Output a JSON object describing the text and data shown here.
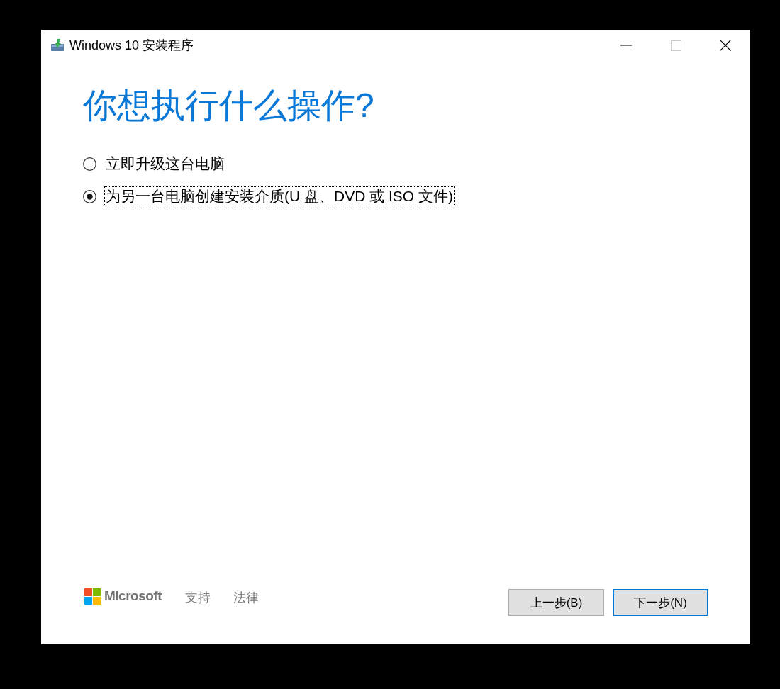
{
  "window": {
    "title": "Windows 10 安装程序",
    "caption_buttons": [
      {
        "kind": "minimize",
        "disabled": false
      },
      {
        "kind": "maximize",
        "disabled": true
      },
      {
        "kind": "close",
        "disabled": false
      }
    ]
  },
  "heading": "你想执行什么操作?",
  "options": [
    {
      "label": "立即升级这台电脑",
      "selected": false,
      "focused": false
    },
    {
      "label": "为另一台电脑创建安装介质(U 盘、DVD 或 ISO 文件)",
      "selected": true,
      "focused": true
    }
  ],
  "footer": {
    "brand": "Microsoft",
    "links": [
      "支持",
      "法律"
    ]
  },
  "buttons": [
    {
      "label": "上一步(B)",
      "default": false
    },
    {
      "label": "下一步(N)",
      "default": true
    }
  ]
}
